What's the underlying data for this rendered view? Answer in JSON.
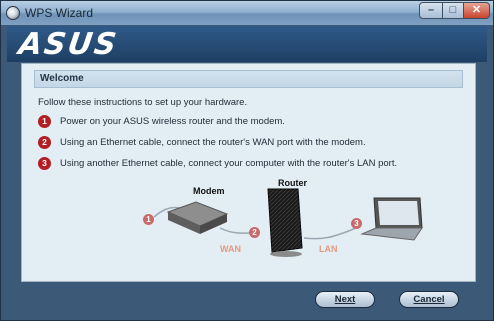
{
  "window": {
    "title": "WPS Wizard",
    "controls": {
      "minimize": "–",
      "maximize": "□",
      "close": "✕"
    }
  },
  "banner": {
    "logo": "ASUS"
  },
  "section": {
    "title": "Welcome"
  },
  "intro": "Follow these instructions to set up your hardware.",
  "steps": [
    {
      "num": "1",
      "text": "Power on your ASUS wireless router and the modem."
    },
    {
      "num": "2",
      "text": "Using an Ethernet cable, connect the router's WAN port with the modem."
    },
    {
      "num": "3",
      "text": "Using another Ethernet cable, connect your computer with the router's LAN port."
    }
  ],
  "diagram": {
    "modem_label": "Modem",
    "router_label": "Router",
    "wan_label": "WAN",
    "lan_label": "LAN",
    "badges": [
      "1",
      "2",
      "3"
    ]
  },
  "buttons": {
    "next": "Next",
    "cancel": "Cancel"
  },
  "colors": {
    "accent_red": "#b11f24",
    "banner_blue": "#274d77",
    "panel_bg": "#e3eef4"
  }
}
